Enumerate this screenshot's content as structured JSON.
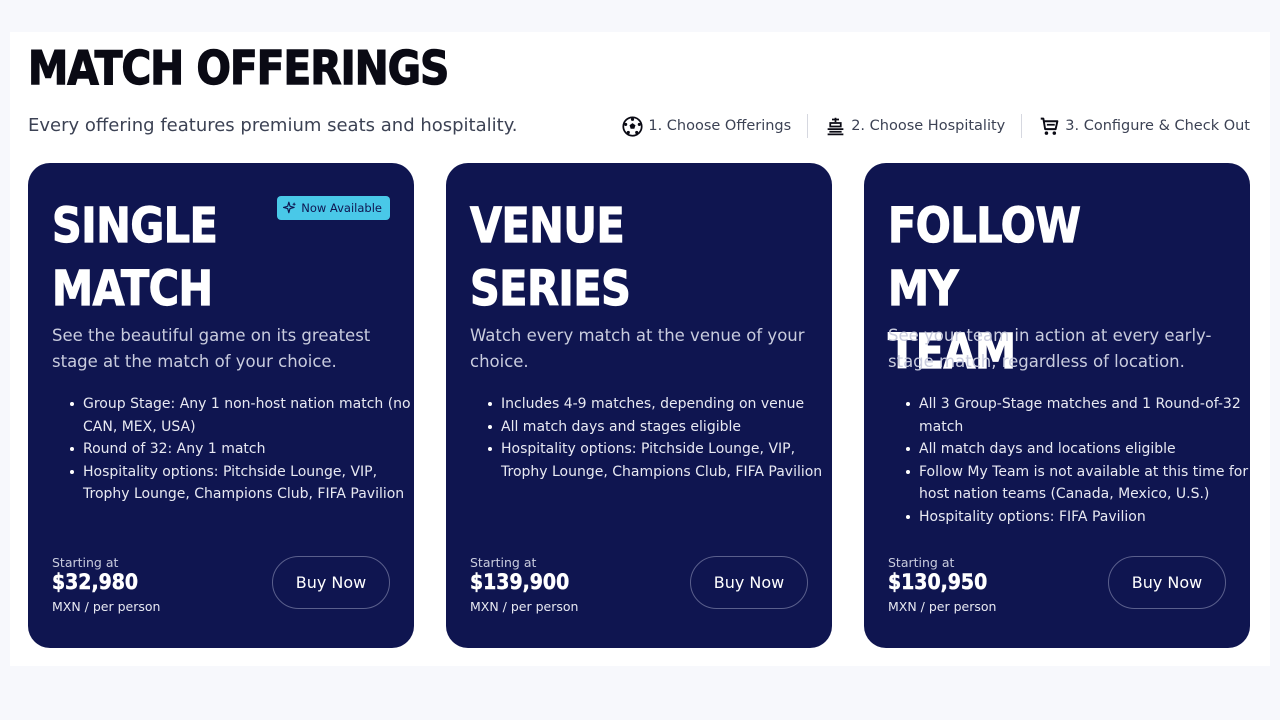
{
  "page": {
    "title": "MATCH OFFERINGS",
    "subtitle": "Every offering features premium seats and hospitality."
  },
  "steps": [
    {
      "label": "1. Choose Offerings",
      "icon": "soccer-ball-icon"
    },
    {
      "label": "2. Choose Hospitality",
      "icon": "hospitality-icon"
    },
    {
      "label": "3. Configure & Check Out",
      "icon": "cart-icon"
    }
  ],
  "cards": [
    {
      "title_line1": "SINGLE",
      "title_line2": "MATCH",
      "badge": "Now Available",
      "description": "See the beautiful game on its greatest stage at the match of your choice.",
      "features": [
        "Group Stage: Any 1 non-host nation match (no CAN, MEX, USA)",
        "Round of 32: Any 1 match",
        "Hospitality options: Pitchside Lounge, VIP, Trophy Lounge, Champions Club, FIFA Pavilion"
      ],
      "starting_label": "Starting at",
      "price": "$32,980",
      "unit": "MXN / per person",
      "button": "Buy Now"
    },
    {
      "title_line1": "VENUE SERIES",
      "title_line2": "",
      "description": "Watch every match at the venue of your choice.",
      "features": [
        "Includes 4-9 matches, depending on venue",
        "All match days and stages eligible",
        "Hospitality options: Pitchside Lounge, VIP, Trophy Lounge, Champions Club, FIFA Pavilion"
      ],
      "starting_label": "Starting at",
      "price": "$139,900",
      "unit": "MXN / per person",
      "button": "Buy Now"
    },
    {
      "title_line1": "FOLLOW MY",
      "title_line2": "TEAM",
      "description": "See your team in action at every early-stage match, regardless of location.",
      "features": [
        "All 3 Group-Stage matches and 1 Round-of-32 match",
        "All match days and locations eligible",
        "Follow My Team is not available at this time for host nation teams (Canada, Mexico, U.S.)",
        "Hospitality options: FIFA Pavilion"
      ],
      "starting_label": "Starting at",
      "price": "$130,950",
      "unit": "MXN / per person",
      "button": "Buy Now"
    }
  ],
  "colors": {
    "card_bg": "#0f1550",
    "badge_bg": "#49c8e8",
    "page_bg": "#f7f8fc"
  }
}
